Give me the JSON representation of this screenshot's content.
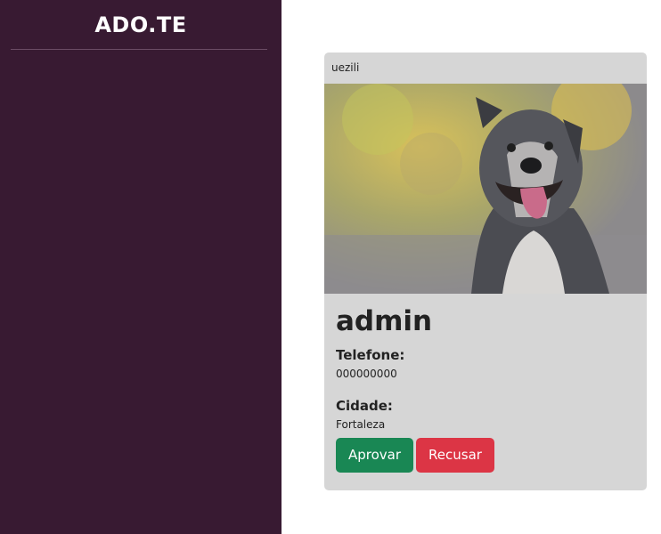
{
  "sidebar": {
    "brand": "ADO.TE"
  },
  "card": {
    "header": "uezili",
    "photo_subject": "dog",
    "title": "admin",
    "fields": [
      {
        "label": "Telefone:",
        "value": "000000000"
      },
      {
        "label": "Cidade:",
        "value": "Fortaleza"
      }
    ],
    "buttons": {
      "approve": "Aprovar",
      "reject": "Recusar"
    }
  },
  "colors": {
    "sidebar_bg": "#381a32",
    "card_bg": "#d6d6d6",
    "approve": "#198754",
    "reject": "#dc3545"
  }
}
